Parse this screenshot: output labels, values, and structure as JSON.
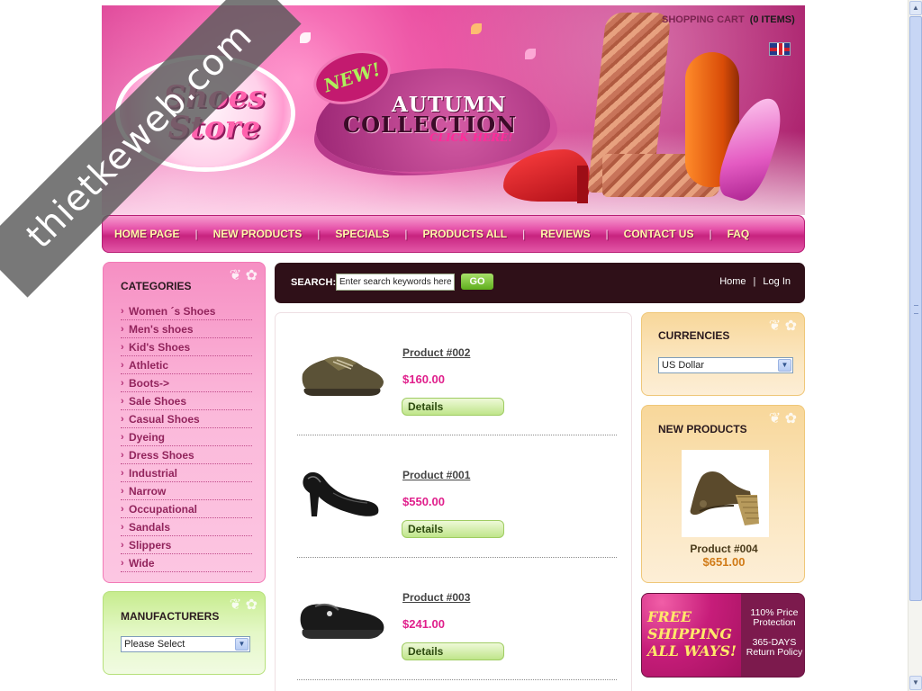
{
  "watermark": "thietkeweb.com",
  "header": {
    "logo_line1": "Shoes",
    "logo_line2": "Store",
    "new_badge": "NEW!",
    "autumn": "AUTUMN",
    "collection": "COLLECTION",
    "click_here": "CLICK HERE!",
    "cart_label": "SHOPPING CART",
    "cart_count": "(0 ITEMS)",
    "language_flag_icon": "uk-flag-icon"
  },
  "nav": [
    "HOME PAGE",
    "NEW PRODUCTS",
    "SPECIALS",
    "PRODUCTS ALL",
    "REVIEWS",
    "CONTACT US",
    "FAQ"
  ],
  "categories": {
    "title": "CATEGORIES",
    "items": [
      "Women ´s Shoes",
      "Men's shoes",
      "Kid's Shoes",
      "Athletic",
      "Boots->",
      "Sale Shoes",
      "Casual Shoes",
      "Dyeing",
      "Dress Shoes",
      "Industrial",
      "Narrow",
      "Occupational",
      "Sandals",
      "Slippers",
      "Wide"
    ]
  },
  "manufacturers": {
    "title": "MANUFACTURERS",
    "select_value": "Please Select"
  },
  "search": {
    "label": "SEARCH:",
    "placeholder": "Enter search keywords here",
    "go": "GO",
    "link_home": "Home",
    "link_sep": "|",
    "link_login": "Log In"
  },
  "products": [
    {
      "name": "Product #002",
      "price": "$160.00",
      "button": "Details",
      "image": "brown-sneaker"
    },
    {
      "name": "Product #001",
      "price": "$550.00",
      "button": "Details",
      "image": "black-pump"
    },
    {
      "name": "Product #003",
      "price": "$241.00",
      "button": "Details",
      "image": "black-mary-jane"
    }
  ],
  "currencies": {
    "title": "CURRENCIES",
    "select_value": "US Dollar"
  },
  "new_products": {
    "title": "NEW PRODUCTS",
    "name": "Product #004",
    "price": "$651.00",
    "image": "wedge-sandal"
  },
  "shipping": {
    "line1": "FREE",
    "line2": "SHIPPING",
    "line3": "ALL WAYS!",
    "right1": "110% Price",
    "right2": "Protection",
    "right3": "365-DAYS",
    "right4": "Return Policy"
  }
}
